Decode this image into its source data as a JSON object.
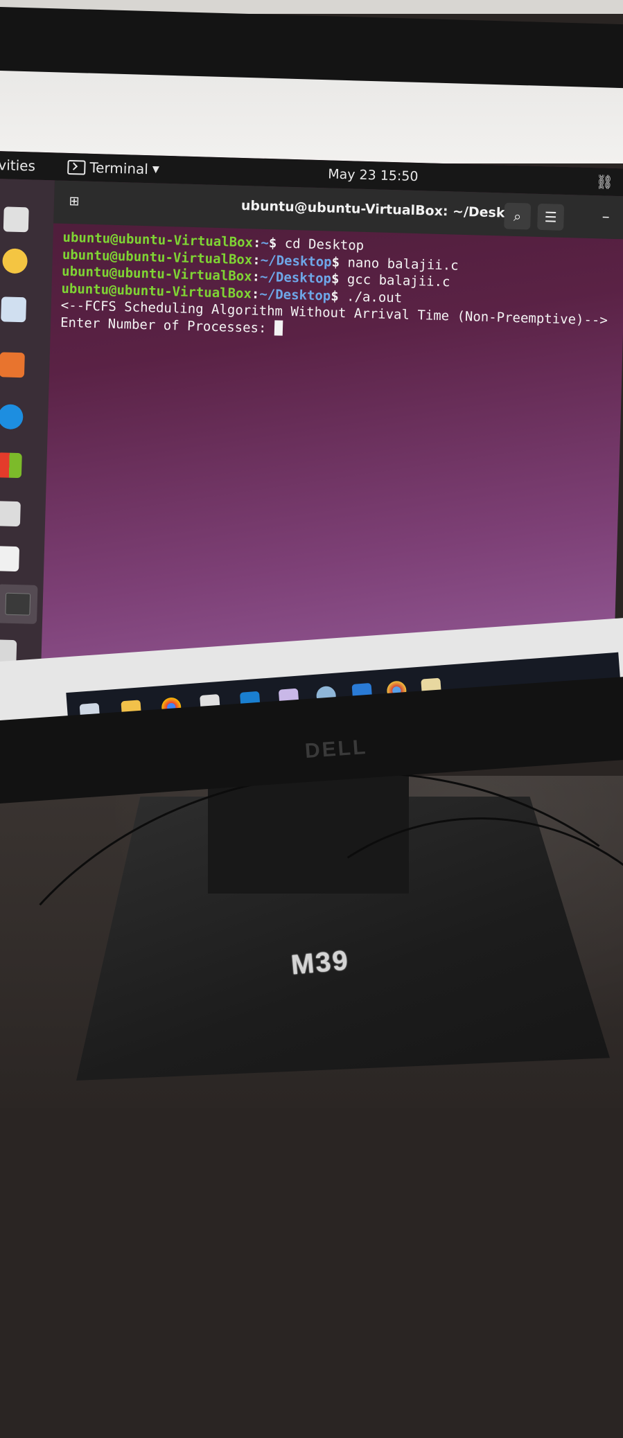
{
  "topbar": {
    "activities": "vities",
    "app_name": "Terminal",
    "clock": "May 23  15:50"
  },
  "window": {
    "title": "ubuntu@ubuntu-VirtualBox: ~/Desktop"
  },
  "terminal": {
    "lines": [
      {
        "user": "ubuntu@ubuntu-VirtualBox",
        "path": "~",
        "cmd": " cd Desktop"
      },
      {
        "user": "ubuntu@ubuntu-VirtualBox",
        "path": "~/Desktop",
        "cmd": " nano balajii.c"
      },
      {
        "user": "ubuntu@ubuntu-VirtualBox",
        "path": "~/Desktop",
        "cmd": " gcc balajii.c"
      },
      {
        "user": "ubuntu@ubuntu-VirtualBox",
        "path": "~/Desktop",
        "cmd": " ./a.out"
      }
    ],
    "output_1": "<--FCFS Scheduling Algorithm Without Arrival Time (Non-Preemptive)-->",
    "output_2": "Enter Number of Processes: "
  },
  "scene": {
    "monitor_brand": "DELL",
    "sticker": "M39"
  },
  "colors": {
    "prompt_user": "#7fd434",
    "prompt_path": "#6ea7e8",
    "desktop_top": "#4a1b36",
    "desktop_bottom": "#9a62a0"
  }
}
